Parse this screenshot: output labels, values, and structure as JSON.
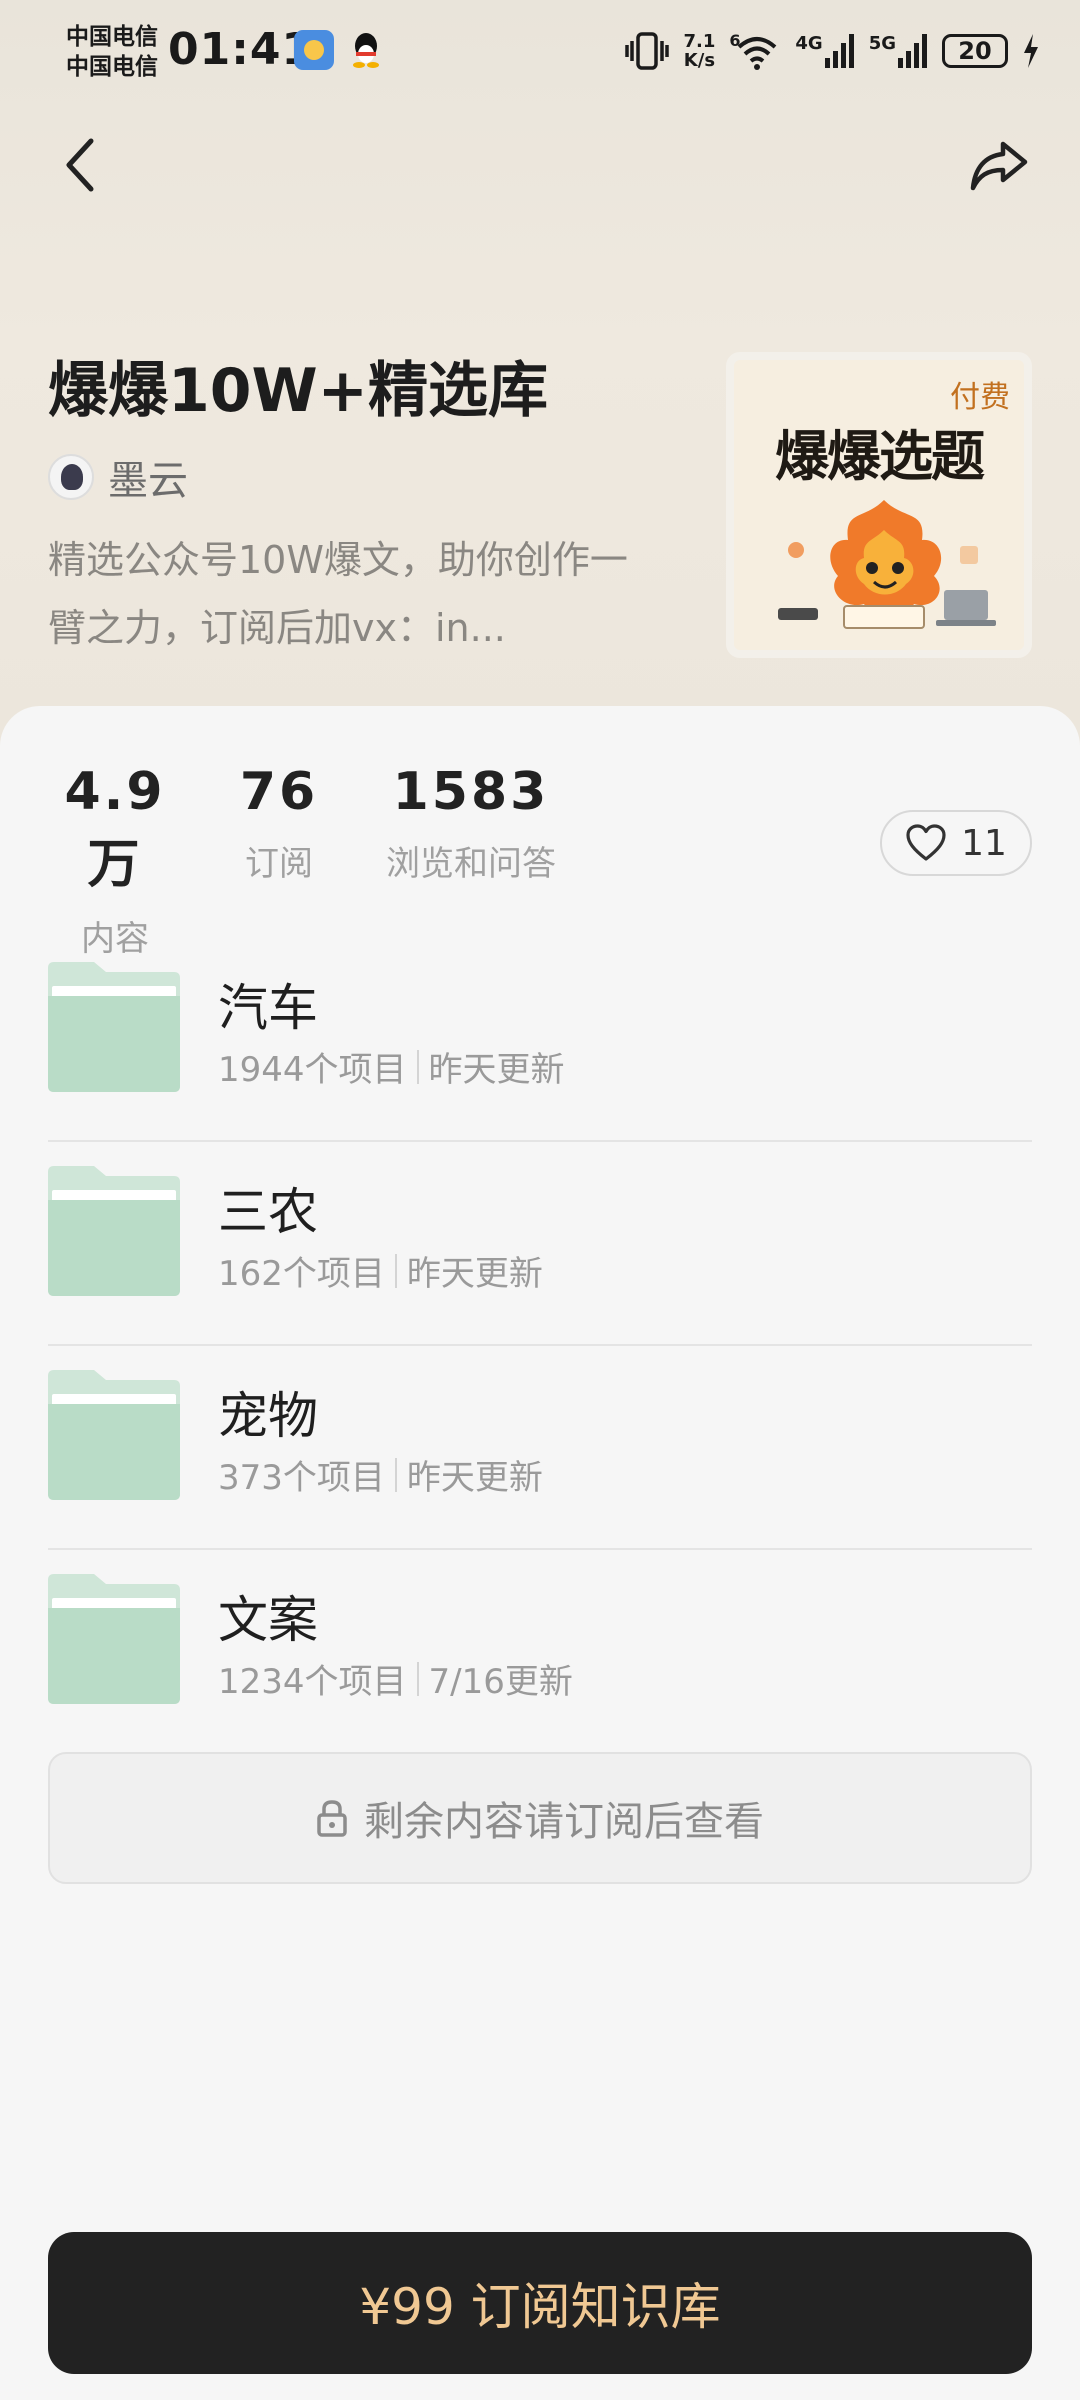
{
  "status_bar": {
    "carrier_1": "中国电信",
    "carrier_2": "中国电信",
    "time": "01:41",
    "net_speed_value": "7.1",
    "net_speed_unit": "K/s",
    "battery": "20",
    "signal_1": "4G",
    "signal_2": "5G",
    "wifi_slot": "6"
  },
  "header": {
    "title": "爆爆10W+精选库",
    "author": "墨云",
    "description": "精选公众号10W爆文，助你创作一臂之力，订阅后加vx：in...",
    "cover": {
      "badge": "付费",
      "title": "爆爆选题"
    }
  },
  "stats": [
    {
      "value": "4.9万",
      "label": "内容"
    },
    {
      "value": "76",
      "label": "订阅"
    },
    {
      "value": "1583",
      "label": "浏览和问答"
    }
  ],
  "like_count": "11",
  "folders": [
    {
      "name": "汽车",
      "count": "1944个项目",
      "updated": "昨天更新"
    },
    {
      "name": "三农",
      "count": "162个项目",
      "updated": "昨天更新"
    },
    {
      "name": "宠物",
      "count": "373个项目",
      "updated": "昨天更新"
    },
    {
      "name": "文案",
      "count": "1234个项目",
      "updated": "7/16更新"
    }
  ],
  "locked_notice": "剩余内容请订阅后查看",
  "subscribe_button": "¥99 订阅知识库",
  "colors": {
    "folder_green": "#cfe6d8",
    "folder_green_dark": "#b9dcc7",
    "button_bg": "#222222",
    "button_text": "#f0c893",
    "paid_badge": "#c2701f"
  },
  "icons": [
    "back-icon",
    "share-icon",
    "heart-icon",
    "lock-icon",
    "folder-icon",
    "vibrate-icon",
    "wifi-icon",
    "signal-icon",
    "battery-icon",
    "charging-icon"
  ]
}
